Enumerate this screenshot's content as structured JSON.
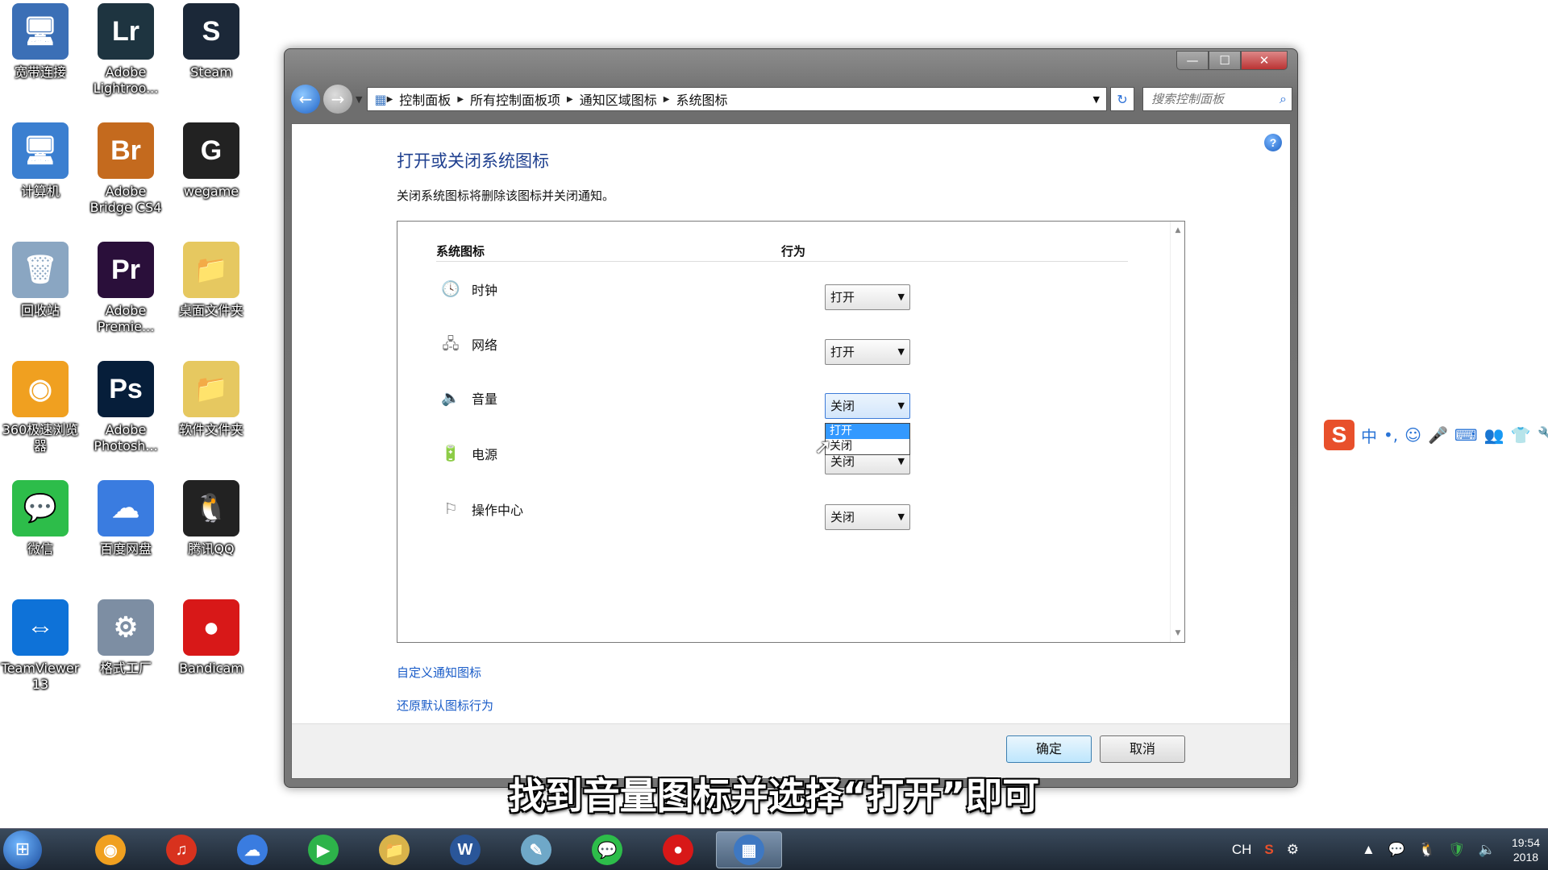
{
  "desktop": {
    "icons": [
      {
        "label": "宽带连接",
        "glyph": "🖥",
        "color": "#3b6fb6"
      },
      {
        "label": "Adobe Lightroo...",
        "glyph": "Lr",
        "color": "#1e3440"
      },
      {
        "label": "Steam",
        "glyph": "S",
        "color": "#1b2838"
      },
      {
        "label": "计算机",
        "glyph": "🖥",
        "color": "#3b7fd0"
      },
      {
        "label": "Adobe Bridge CS4",
        "glyph": "Br",
        "color": "#c46a1e"
      },
      {
        "label": "wegame",
        "glyph": "G",
        "color": "#222"
      },
      {
        "label": "回收站",
        "glyph": "🗑",
        "color": "#8aa6c2"
      },
      {
        "label": "Adobe Premie...",
        "glyph": "Pr",
        "color": "#2a0f3a"
      },
      {
        "label": "桌面文件夹",
        "glyph": "📁",
        "color": "#e6c860"
      },
      {
        "label": "360极速浏览器",
        "glyph": "◉",
        "color": "#f0a020"
      },
      {
        "label": "Adobe Photosh...",
        "glyph": "Ps",
        "color": "#061e3a"
      },
      {
        "label": "软件文件夹",
        "glyph": "📁",
        "color": "#e6c860"
      },
      {
        "label": "微信",
        "glyph": "💬",
        "color": "#2dbd4a"
      },
      {
        "label": "百度网盘",
        "glyph": "☁",
        "color": "#3a7ce0"
      },
      {
        "label": "腾讯QQ",
        "glyph": "🐧",
        "color": "#222"
      },
      {
        "label": "TeamViewer 13",
        "glyph": "⇔",
        "color": "#0e72d8"
      },
      {
        "label": "格式工厂",
        "glyph": "⚙",
        "color": "#7d8ea3"
      },
      {
        "label": "Bandicam",
        "glyph": "●",
        "color": "#d81818"
      }
    ]
  },
  "window": {
    "captions": {
      "minimize": "—",
      "maximize": "☐",
      "close": "✕"
    },
    "nav": {
      "back": "←",
      "forward": "→",
      "dropdown": "▼",
      "refresh": "↻"
    },
    "breadcrumb": [
      "控制面板",
      "所有控制面板项",
      "通知区域图标",
      "系统图标"
    ],
    "breadcrumb_sep": "▶",
    "search": {
      "placeholder": "搜索控制面板"
    },
    "help": "?",
    "page_title": "打开或关闭系统图标",
    "description": "关闭系统图标将删除该图标并关闭通知。",
    "table": {
      "col_icon": "系统图标",
      "col_behavior": "行为",
      "rows": [
        {
          "name": "时钟",
          "icon": "clock-icon",
          "glyph": "🕓",
          "value": "打开"
        },
        {
          "name": "网络",
          "icon": "network-icon",
          "glyph": "🖧",
          "value": "打开"
        },
        {
          "name": "音量",
          "icon": "speaker-icon",
          "glyph": "🔈",
          "value": "关闭"
        },
        {
          "name": "电源",
          "icon": "power-icon",
          "glyph": "🔋",
          "value": "关闭"
        },
        {
          "name": "操作中心",
          "icon": "flag-icon",
          "glyph": "⚐",
          "value": "关闭"
        }
      ],
      "dropdown_options": [
        "打开",
        "关闭"
      ],
      "dropdown_arrow": "▼"
    },
    "links": {
      "customize": "自定义通知图标",
      "restore": "还原默认图标行为"
    },
    "buttons": {
      "ok": "确定",
      "cancel": "取消"
    }
  },
  "subtitle": "找到音量图标并选择“打开”即可",
  "ime": {
    "logo": "S",
    "items": [
      "中",
      "•,",
      "☺",
      "🎤",
      "⌨",
      "👥",
      "👕",
      "🔧"
    ]
  },
  "taskbar": {
    "start": "⊞",
    "apps": [
      {
        "name": "360-browser",
        "glyph": "◉",
        "color": "#f0a020"
      },
      {
        "name": "netease-music",
        "glyph": "♫",
        "color": "#d8321e"
      },
      {
        "name": "baidu-netdisk",
        "glyph": "☁",
        "color": "#3a7ce0"
      },
      {
        "name": "media-player",
        "glyph": "▶",
        "color": "#2db34a"
      },
      {
        "name": "file-explorer",
        "glyph": "📁",
        "color": "#d9b34a"
      },
      {
        "name": "word",
        "glyph": "W",
        "color": "#2a5699"
      },
      {
        "name": "notepad",
        "glyph": "✎",
        "color": "#6fa8c8"
      },
      {
        "name": "wechat",
        "glyph": "💬",
        "color": "#2dbd4a"
      },
      {
        "name": "bandicam",
        "glyph": "●",
        "color": "#d81818"
      },
      {
        "name": "control-panel",
        "glyph": "▦",
        "color": "#3e78c2"
      }
    ],
    "tray": {
      "lang": "CH",
      "clock_time": "19:54",
      "clock_date": "2018"
    }
  }
}
